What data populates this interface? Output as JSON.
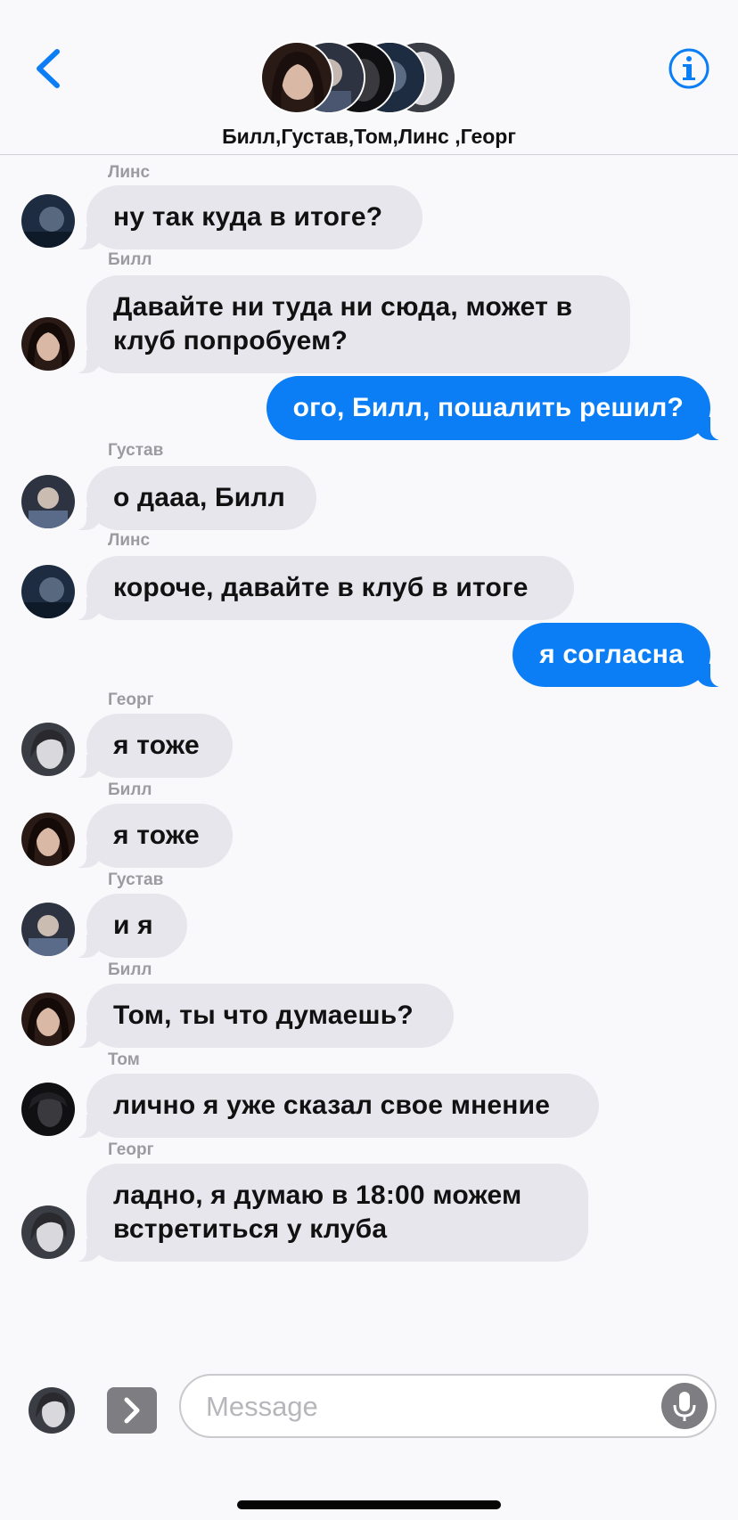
{
  "header": {
    "group_title": "Билл,Густав,Том,Линс ,Георг",
    "back_icon": "chevron-left-icon",
    "info_icon": "info-circle-icon",
    "accent_color": "#0b7ef5"
  },
  "messages": [
    {
      "sender": "Линс",
      "text": "ну так куда в итоге?",
      "direction": "incoming"
    },
    {
      "sender": "Билл",
      "text": "Давайте ни туда ни сюда, может в клуб попробуем?",
      "direction": "incoming"
    },
    {
      "sender": "",
      "text": "ого, Билл, пошалить решил?",
      "direction": "outgoing"
    },
    {
      "sender": "Густав",
      "text": "о дааа, Билл",
      "direction": "incoming"
    },
    {
      "sender": "Линс",
      "text": "короче, давайте в клуб в итоге",
      "direction": "incoming"
    },
    {
      "sender": "",
      "text": "я согласна",
      "direction": "outgoing"
    },
    {
      "sender": "Георг",
      "text": "я тоже",
      "direction": "incoming"
    },
    {
      "sender": "Билл",
      "text": "я тоже",
      "direction": "incoming"
    },
    {
      "sender": "Густав",
      "text": " и я",
      "direction": "incoming"
    },
    {
      "sender": "Билл",
      "text": "Том, ты что думаешь?",
      "direction": "incoming"
    },
    {
      "sender": "Том",
      "text": "лично я уже сказал свое мнение",
      "direction": "incoming"
    },
    {
      "sender": "Георг",
      "text": " ладно, я думаю в 18:00 можем встретиться у клуба",
      "direction": "incoming"
    }
  ],
  "composer": {
    "placeholder": "Message",
    "value": "",
    "apps_icon": "chevron-right-icon",
    "mic_icon": "microphone-icon"
  },
  "colors": {
    "incoming_bubble": "#e8e6ed",
    "outgoing_bubble": "#0b7ef5",
    "background": "#f9f9fb"
  }
}
